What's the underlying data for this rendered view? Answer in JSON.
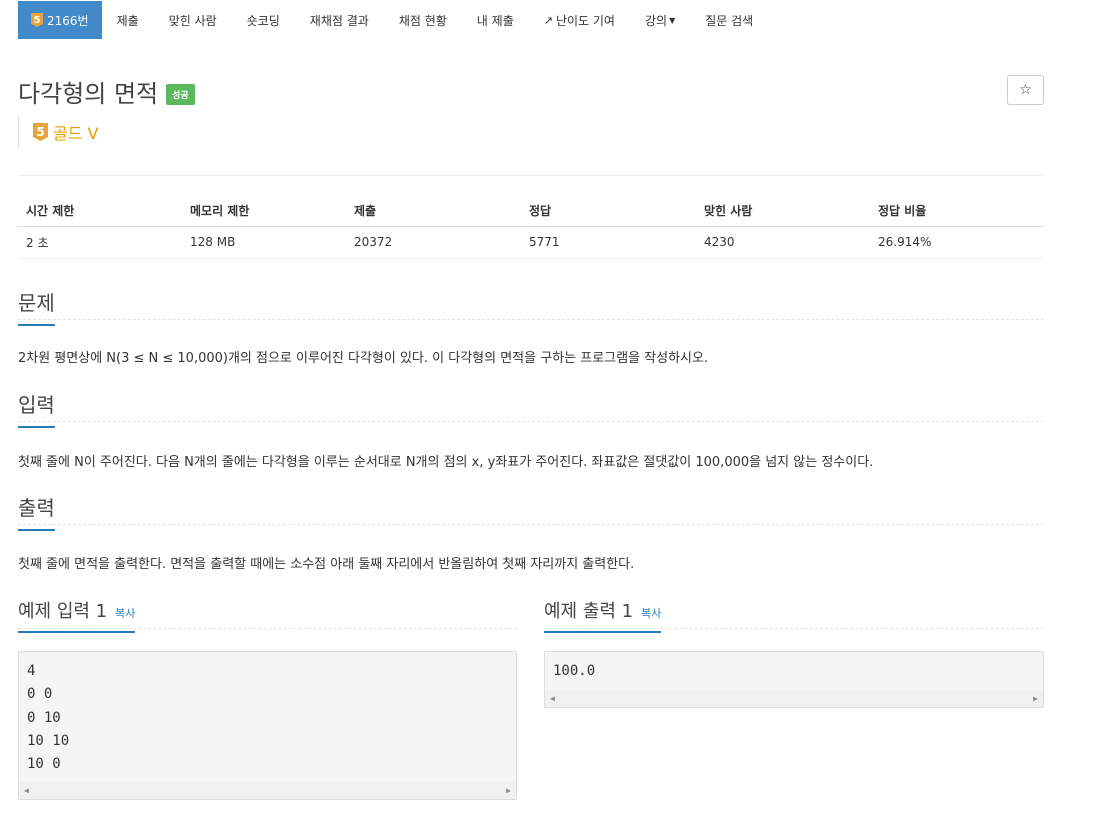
{
  "nav": {
    "problem_id": "2166번",
    "tier_number": "5",
    "items": [
      "제출",
      "맞힌 사람",
      "숏코딩",
      "재채점 결과",
      "채점 현황",
      "내 제출",
      "난이도 기여",
      "강의",
      "질문 검색"
    ]
  },
  "problem": {
    "title": "다각형의 면적",
    "status_label": "성공",
    "star_icon": "☆",
    "tier_number": "5",
    "tier_label": "골드 V"
  },
  "info_table": {
    "headers": [
      "시간 제한",
      "메모리 제한",
      "제출",
      "정답",
      "맞힌 사람",
      "정답 비율"
    ],
    "values": [
      "2 초",
      "128 MB",
      "20372",
      "5771",
      "4230",
      "26.914%"
    ]
  },
  "sections": {
    "description": {
      "title": "문제",
      "text": "2차원 평면상에 N(3 ≤ N ≤ 10,000)개의 점으로 이루어진 다각형이 있다. 이 다각형의 면적을 구하는 프로그램을 작성하시오."
    },
    "input": {
      "title": "입력",
      "text": "첫째 줄에 N이 주어진다. 다음 N개의 줄에는 다각형을 이루는 순서대로 N개의 점의 x, y좌표가 주어진다. 좌표값은 절댓값이 100,000을 넘지 않는 정수이다."
    },
    "output": {
      "title": "출력",
      "text": "첫째 줄에 면적을 출력한다. 면적을 출력할 때에는 소수점 아래 둘째 자리에서 반올림하여 첫째 자리까지 출력한다."
    }
  },
  "examples": {
    "input": {
      "title": "예제 입력 1",
      "copy": "복사",
      "lines": [
        "4",
        "0 0",
        "0 10",
        "10 10",
        "10 0"
      ]
    },
    "output": {
      "title": "예제 출력 1",
      "copy": "복사",
      "lines": [
        "100.0"
      ]
    }
  },
  "colors": {
    "primary": "#428bca",
    "success": "#5cb85c",
    "gold": "#ec9a00",
    "section_underline": "#2a7ab8"
  }
}
